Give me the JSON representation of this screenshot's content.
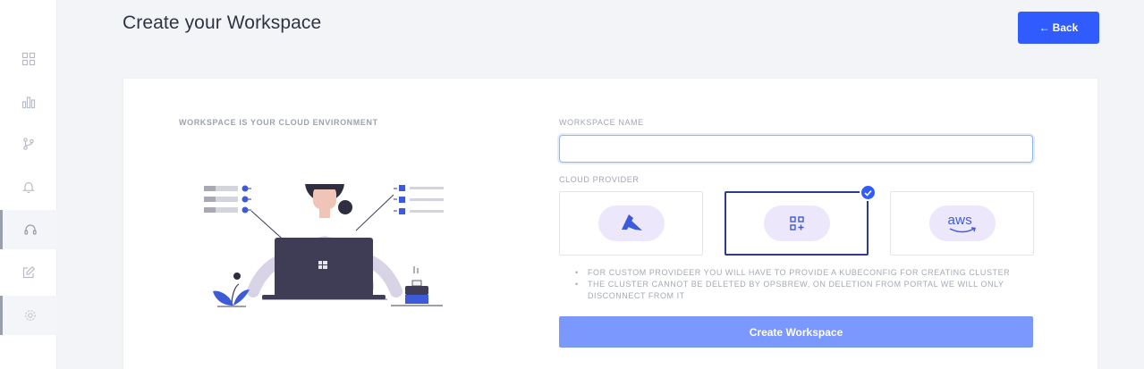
{
  "page": {
    "title": "Create your Workspace"
  },
  "header": {
    "back_label": "Back"
  },
  "sidebar": {
    "items": [
      {
        "icon": "grid-icon",
        "active": false
      },
      {
        "icon": "bar-chart-icon",
        "active": false
      },
      {
        "icon": "git-branch-icon",
        "active": false
      },
      {
        "icon": "bell-icon",
        "active": false
      },
      {
        "icon": "headset-icon",
        "active": true
      },
      {
        "icon": "edit-icon",
        "active": false
      },
      {
        "icon": "settings-icon",
        "active": true
      }
    ]
  },
  "left_panel": {
    "heading": "WORKSPACE IS YOUR CLOUD ENVIRONMENT"
  },
  "form": {
    "workspace_name_label": "WORKSPACE NAME",
    "workspace_name_value": "",
    "cloud_provider_label": "CLOUD PROVIDER",
    "providers": [
      {
        "name": "azure",
        "icon": "azure-icon",
        "selected": false
      },
      {
        "name": "custom",
        "icon": "custom-provider-icon",
        "selected": true
      },
      {
        "name": "aws",
        "icon": "aws-icon",
        "label": "aws",
        "selected": false
      }
    ],
    "notes": [
      "FOR CUSTOM PROVIDEER YOU WILL HAVE TO PROVIDE A KUBECONFIG FOR CREATING CLUSTER",
      "THE CLUSTER CANNOT BE DELETED BY OPSBREW, ON DELETION FROM PORTAL WE WILL ONLY DISCONNECT FROM IT"
    ],
    "submit_label": "Create Workspace"
  },
  "colors": {
    "accent": "#2f5bff",
    "accent_light": "#7b98ff",
    "selected_border": "#2b3c8e",
    "pill_bg": "#ece7fb",
    "text_dark": "#2f3441"
  }
}
